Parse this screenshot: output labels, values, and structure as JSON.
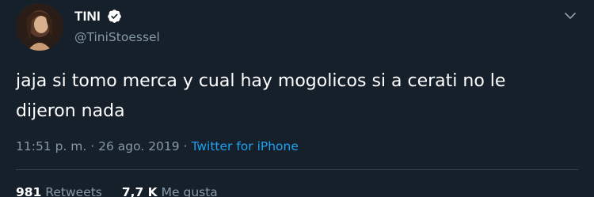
{
  "tweet": {
    "author": {
      "display_name": "TINI",
      "handle": "@TiniStoessel",
      "verified": true,
      "verified_icon": "verified-badge-icon"
    },
    "text": "jaja si tomo merca y cual hay mogolicos si a cerati no le dijeron nada",
    "time": "11:51 p. m.",
    "separator": "·",
    "date": "26 ago. 2019",
    "source": "Twitter for iPhone",
    "stats": {
      "retweets_count": "981",
      "retweets_label": "Retweets",
      "likes_count": "7,7 K",
      "likes_label": "Me gusta"
    },
    "menu_icon": "chevron-down-icon"
  },
  "colors": {
    "background": "#15202b",
    "text_primary": "#ffffff",
    "text_secondary": "#8899a6",
    "accent": "#1da1f2",
    "divider": "#38444d"
  }
}
